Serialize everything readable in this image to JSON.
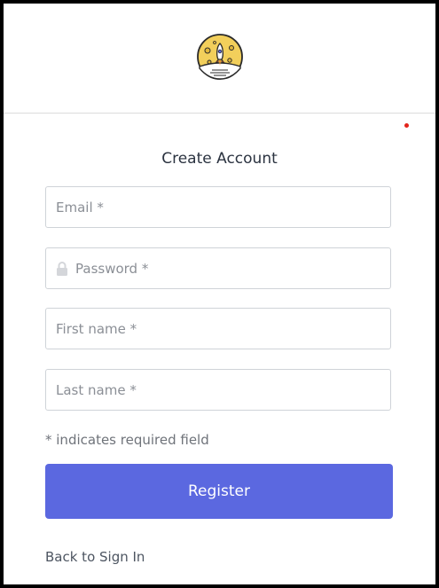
{
  "header": {
    "logo_icon": "rocket-moon-logo-icon"
  },
  "form": {
    "title": "Create Account",
    "email_placeholder": "Email *",
    "password_placeholder": "Password *",
    "password_icon": "lock-icon",
    "first_name_placeholder": "First name *",
    "last_name_placeholder": "Last name *",
    "required_hint": "* indicates required field",
    "register_label": "Register",
    "back_link": "Back to Sign In"
  },
  "colors": {
    "accent": "#5b68e0",
    "notification_dot": "#e3241b",
    "logo_yellow": "#f2cf5b"
  }
}
